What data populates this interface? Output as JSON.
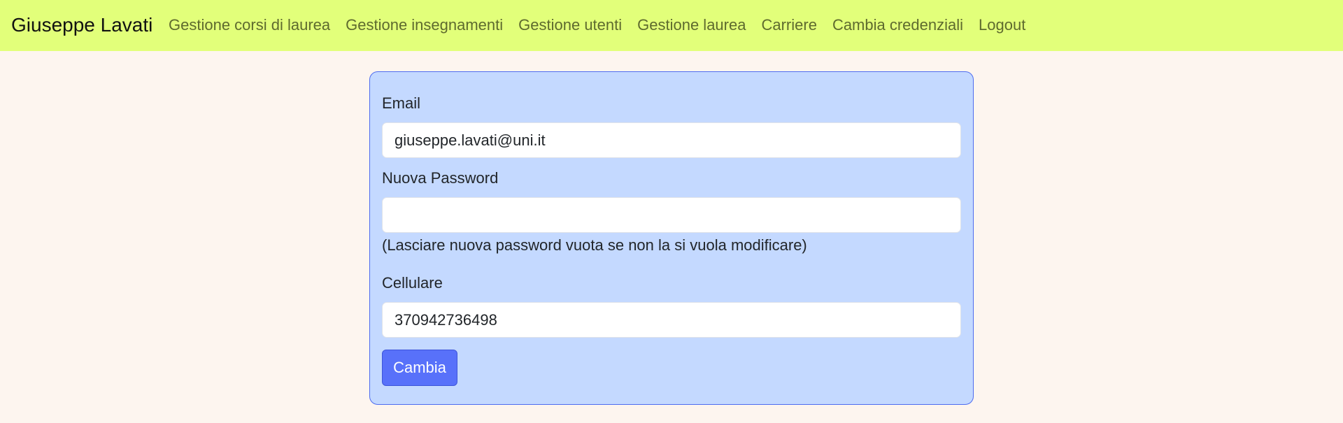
{
  "navbar": {
    "brand": "Giuseppe Lavati",
    "links": [
      "Gestione corsi di laurea",
      "Gestione insegnamenti",
      "Gestione utenti",
      "Gestione laurea",
      "Carriere",
      "Cambia credenziali",
      "Logout"
    ]
  },
  "form": {
    "email_label": "Email",
    "email_value": "giuseppe.lavati@uni.it",
    "password_label": "Nuova Password",
    "password_value": "",
    "password_hint": "(Lasciare nuova password vuota se non la si vuola modificare)",
    "phone_label": "Cellulare",
    "phone_value": "370942736498",
    "submit_label": "Cambia"
  },
  "colors": {
    "navbar_bg": "#e2ff7a",
    "page_bg": "#fdf5ef",
    "card_bg": "#c4d9ff",
    "card_border": "#4d6bf0",
    "button_bg": "#5871fa"
  }
}
